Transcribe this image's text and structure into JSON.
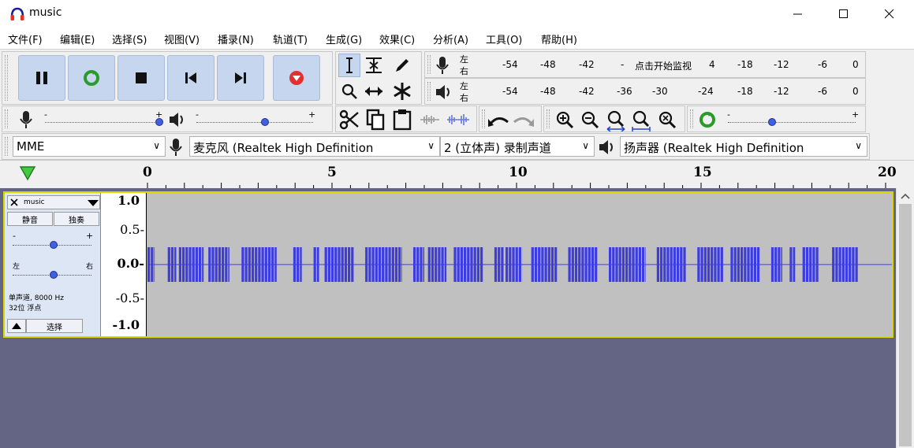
{
  "window": {
    "title": "music"
  },
  "menu": [
    "文件(F)",
    "编辑(E)",
    "选择(S)",
    "视图(V)",
    "播录(N)",
    "轨道(T)",
    "生成(G)",
    "效果(C)",
    "分析(A)",
    "工具(O)",
    "帮助(H)"
  ],
  "meter": {
    "rec_ticks": [
      "-54",
      "-48",
      "-42",
      "-",
      "点击开始监视",
      "4",
      "-18",
      "-12",
      "-6",
      "0"
    ],
    "play_ticks": [
      "-54",
      "-48",
      "-42",
      "-36",
      "-30",
      "-24",
      "-18",
      "-12",
      "-6",
      "0"
    ],
    "left": "左",
    "right": "右"
  },
  "mixer": {
    "minus": "-",
    "plus": "+"
  },
  "devices": {
    "host": "MME",
    "mic": "麦克风 (Realtek High Definition",
    "channels": "2 (立体声) 录制声道",
    "speaker": "扬声器 (Realtek High Definition"
  },
  "ruler": [
    "0",
    "5",
    "10",
    "15",
    "20"
  ],
  "track": {
    "name": "music",
    "mute": "静音",
    "solo": "独奏",
    "gain_minus": "-",
    "gain_plus": "+",
    "pan_left": "左",
    "pan_right": "右",
    "info1": "单声道, 8000 Hz",
    "info2": "32位 浮点",
    "select": "选择",
    "vruler": [
      "1.0",
      "0.5-",
      "0.0-",
      "-0.5-",
      "-1.0"
    ]
  },
  "colors": {
    "wave": "#3c3ce0",
    "track_bg": "#c0c0c0",
    "background": "#646484",
    "track_border": "#d8d800"
  },
  "waveform_segments": [
    [
      0.0,
      0.195
    ],
    [
      0.55,
      0.78
    ],
    [
      0.85,
      1.52
    ],
    [
      1.65,
      2.22
    ],
    [
      2.55,
      3.5
    ],
    [
      3.95,
      4.18
    ],
    [
      4.5,
      4.65
    ],
    [
      4.8,
      5.6
    ],
    [
      5.9,
      6.9
    ],
    [
      7.2,
      7.5
    ],
    [
      7.6,
      8.1
    ],
    [
      8.3,
      9.1
    ],
    [
      9.4,
      9.65
    ],
    [
      9.7,
      10.15
    ],
    [
      10.4,
      11.1
    ],
    [
      11.4,
      12.2
    ],
    [
      12.5,
      13.5
    ],
    [
      13.8,
      14.6
    ],
    [
      14.9,
      15.6
    ],
    [
      15.8,
      16.6
    ],
    [
      16.9,
      17.2
    ],
    [
      17.4,
      17.55
    ],
    [
      17.75,
      18.2
    ],
    [
      18.55,
      19.25
    ]
  ]
}
